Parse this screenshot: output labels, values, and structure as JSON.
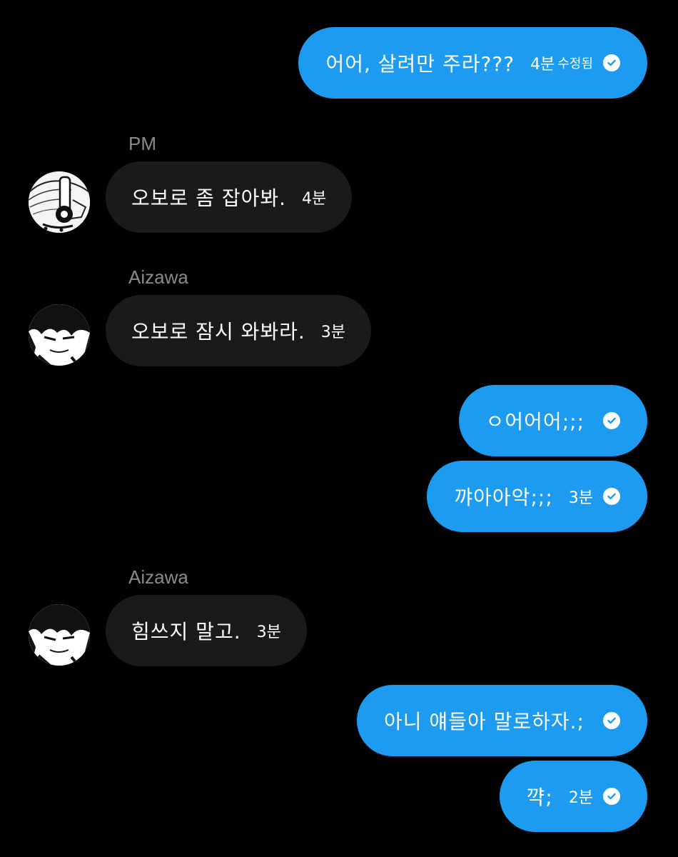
{
  "colors": {
    "background": "#000000",
    "outgoing_bubble": "#1d9bf0",
    "incoming_bubble": "#1a1a1d",
    "sender_name": "#8b8b8f",
    "text": "#ffffff"
  },
  "messages": [
    {
      "direction": "outgoing",
      "text": "어어, 살려만 주라???",
      "time": "4분",
      "edited": "수정됨",
      "status_icon": "check-circle-icon"
    },
    {
      "direction": "incoming",
      "sender": "PM",
      "avatar_icon": "headphone-character-avatar",
      "text": "오보로 좀 잡아봐.",
      "time": "4분"
    },
    {
      "direction": "incoming",
      "sender": "Aizawa",
      "avatar_icon": "dark-hair-character-avatar",
      "text": "오보로 잠시 와봐라.",
      "time": "3분"
    },
    {
      "direction": "outgoing",
      "text": "ㅇ어어어;;;",
      "status_icon": "check-circle-icon"
    },
    {
      "direction": "outgoing",
      "text": "꺄아아악;;;",
      "time": "3분",
      "status_icon": "check-circle-icon"
    },
    {
      "direction": "incoming",
      "sender": "Aizawa",
      "avatar_icon": "dark-hair-character-avatar",
      "text": "힘쓰지 말고.",
      "time": "3분"
    },
    {
      "direction": "outgoing",
      "text": "아니 얘들아 말로하자.;",
      "status_icon": "check-circle-icon"
    },
    {
      "direction": "outgoing",
      "text": "꺅;",
      "time": "2분",
      "status_icon": "check-circle-icon"
    }
  ]
}
